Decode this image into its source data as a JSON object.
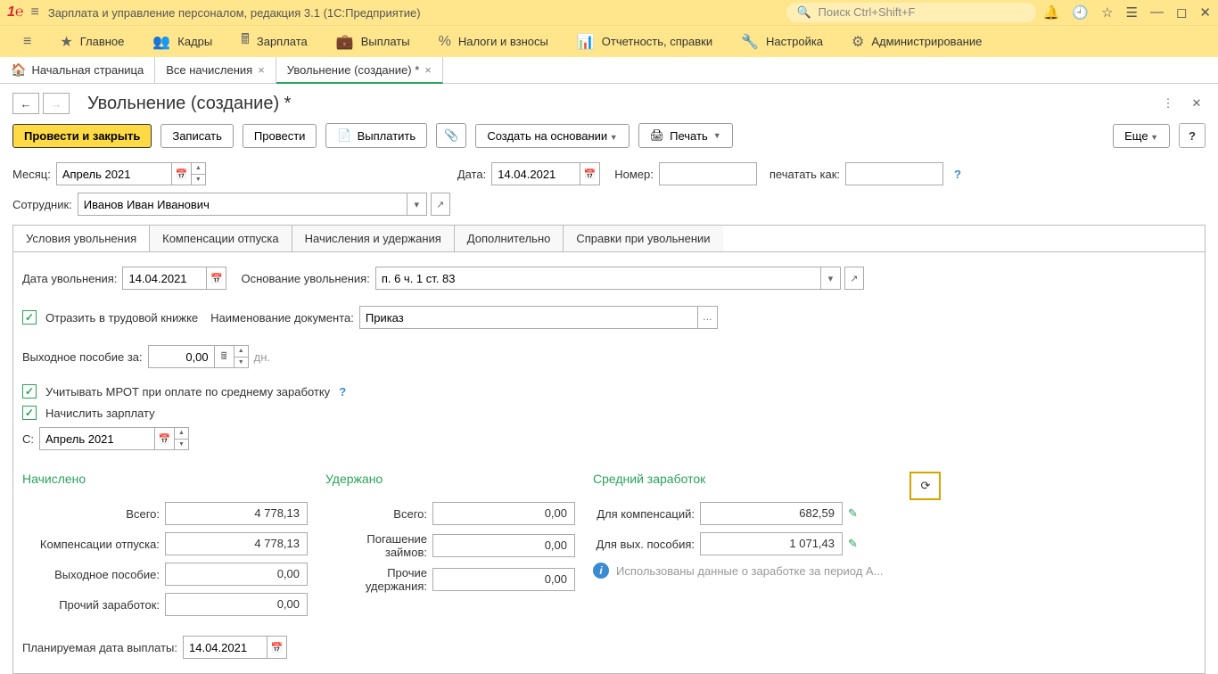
{
  "app": {
    "title": "Зарплата и управление персоналом, редакция 3.1  (1С:Предприятие)",
    "search_placeholder": "Поиск Ctrl+Shift+F"
  },
  "mainmenu": [
    {
      "label": "Главное"
    },
    {
      "label": "Кадры"
    },
    {
      "label": "Зарплата"
    },
    {
      "label": "Выплаты"
    },
    {
      "label": "Налоги и взносы"
    },
    {
      "label": "Отчетность, справки"
    },
    {
      "label": "Настройка"
    },
    {
      "label": "Администрирование"
    }
  ],
  "tabs_row": {
    "home": "Начальная страница",
    "tab1": "Все начисления",
    "tab2": "Увольнение (создание) *"
  },
  "page": {
    "title": "Увольнение (создание) *"
  },
  "toolbar": {
    "post_close": "Провести и закрыть",
    "write": "Записать",
    "post": "Провести",
    "pay": "Выплатить",
    "create_based": "Создать на основании",
    "print": "Печать",
    "more": "Еще",
    "help": "?"
  },
  "header_fields": {
    "month_label": "Месяц:",
    "month_value": "Апрель 2021",
    "date_label": "Дата:",
    "date_value": "14.04.2021",
    "number_label": "Номер:",
    "number_value": "",
    "print_as_label": "печатать как:",
    "print_as_value": "",
    "employee_label": "Сотрудник:",
    "employee_value": "Иванов Иван Иванович"
  },
  "inner_tabs": [
    "Условия увольнения",
    "Компенсации отпуска",
    "Начисления и удержания",
    "Дополнительно",
    "Справки при увольнении"
  ],
  "conditions": {
    "dismiss_date_label": "Дата увольнения:",
    "dismiss_date_value": "14.04.2021",
    "reason_label": "Основание увольнения:",
    "reason_value": "п. 6 ч. 1 ст. 83",
    "workbook_label": "Отразить в трудовой книжке",
    "docname_label": "Наименование документа:",
    "docname_value": "Приказ",
    "severance_label": "Выходное пособие за:",
    "severance_value": "0,00",
    "severance_unit": "дн.",
    "mrot_label": "Учитывать МРОТ при оплате по среднему заработку",
    "accrue_label": "Начислить зарплату",
    "from_label": "С:",
    "from_value": "Апрель 2021"
  },
  "totals": {
    "accrued_header": "Начислено",
    "withheld_header": "Удержано",
    "avg_header": "Средний заработок",
    "rows": {
      "total_label": "Всего:",
      "accrued_total": "4 778,13",
      "vacation_comp_label": "Компенсации отпуска:",
      "vacation_comp": "4 778,13",
      "severance_label": "Выходное пособие:",
      "severance": "0,00",
      "other_label": "Прочий заработок:",
      "other": "0,00",
      "withheld_total": "0,00",
      "loan_label": "Погашение займов:",
      "loan": "0,00",
      "other_withheld_label": "Прочие удержания:",
      "other_withheld": "0,00",
      "for_comp_label": "Для компенсаций:",
      "for_comp": "682,59",
      "for_sev_label": "Для вых. пособия:",
      "for_sev": "1 071,43",
      "info_note": "Использованы данные о заработке за период А..."
    }
  },
  "planned": {
    "label": "Планируемая дата выплаты:",
    "value": "14.04.2021"
  }
}
